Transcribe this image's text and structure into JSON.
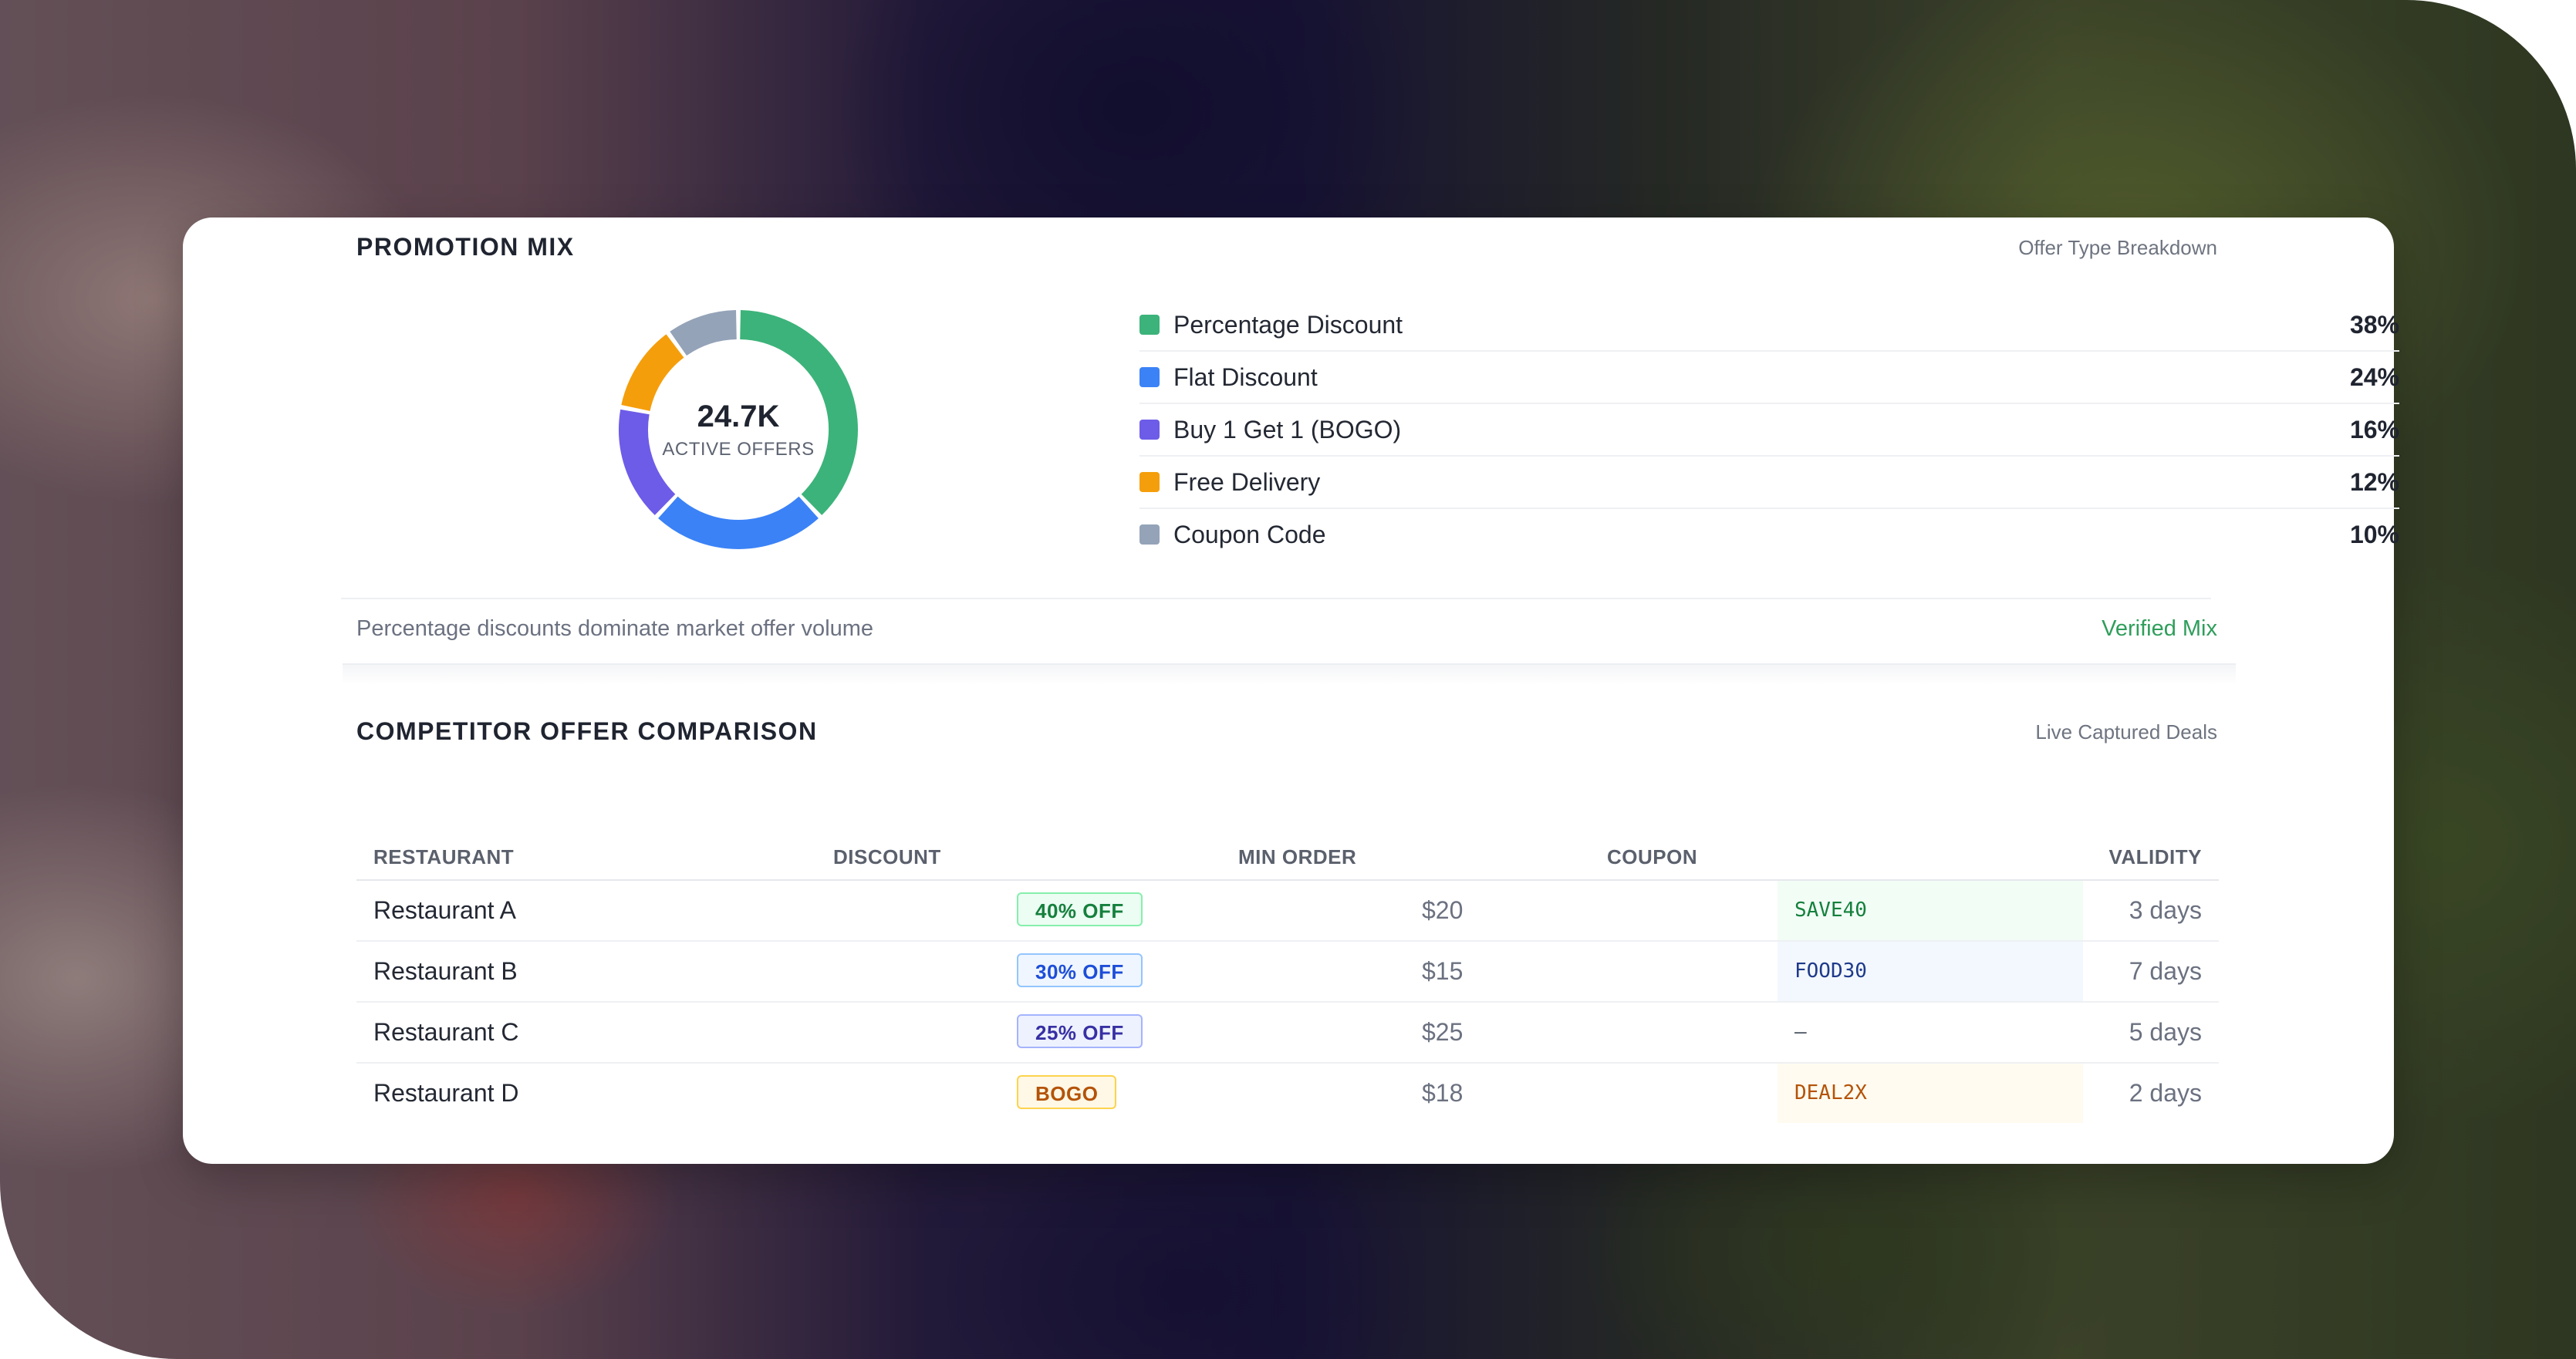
{
  "promotion_mix": {
    "title": "PROMOTION MIX",
    "subtitle": "Offer Type Breakdown",
    "donut": {
      "value": "24.7K",
      "label": "ACTIVE OFFERS"
    },
    "items": [
      {
        "label": "Percentage Discount",
        "value": "38%",
        "share": 38,
        "color": "#3cb37a"
      },
      {
        "label": "Flat Discount",
        "value": "24%",
        "share": 24,
        "color": "#3b82f6"
      },
      {
        "label": "Buy 1 Get 1 (BOGO)",
        "value": "16%",
        "share": 16,
        "color": "#6d5ce8"
      },
      {
        "label": "Free Delivery",
        "value": "12%",
        "share": 12,
        "color": "#f59e0b"
      },
      {
        "label": "Coupon Code",
        "value": "10%",
        "share": 10,
        "color": "#94a3b8"
      }
    ],
    "note": "Percentage discounts dominate market offer volume",
    "status": "Verified Mix"
  },
  "competitor": {
    "title": "COMPETITOR OFFER COMPARISON",
    "subtitle": "Live Captured Deals",
    "columns": [
      "RESTAURANT",
      "DISCOUNT",
      "MIN ORDER",
      "COUPON",
      "VALIDITY"
    ],
    "rows": [
      {
        "restaurant": "Restaurant A",
        "discount": "40% OFF",
        "min_order": "$20",
        "coupon": "SAVE40",
        "validity": "3 days",
        "badge_bg": "#ecfdf3",
        "badge_border": "#86efac",
        "badge_color": "#15803d",
        "coupon_bg": "#f2fdf6",
        "coupon_color": "#15803d"
      },
      {
        "restaurant": "Restaurant B",
        "discount": "30% OFF",
        "min_order": "$15",
        "coupon": "FOOD30",
        "validity": "7 days",
        "badge_bg": "#eff6ff",
        "badge_border": "#93c5fd",
        "badge_color": "#1d4ed8",
        "coupon_bg": "#f3f8ff",
        "coupon_color": "#1e3a8a"
      },
      {
        "restaurant": "Restaurant C",
        "discount": "25% OFF",
        "min_order": "$25",
        "coupon": "—",
        "validity": "5 days",
        "badge_bg": "#eef2ff",
        "badge_border": "#a5b4fc",
        "badge_color": "#3730a3",
        "coupon_bg": "#ffffff",
        "coupon_color": "#4b5563"
      },
      {
        "restaurant": "Restaurant D",
        "discount": "BOGO",
        "min_order": "$18",
        "coupon": "DEAL2X",
        "validity": "2 days",
        "badge_bg": "#fff8e6",
        "badge_border": "#fcd34d",
        "badge_color": "#b45309",
        "coupon_bg": "#fffbf0",
        "coupon_color": "#b45309"
      }
    ]
  }
}
